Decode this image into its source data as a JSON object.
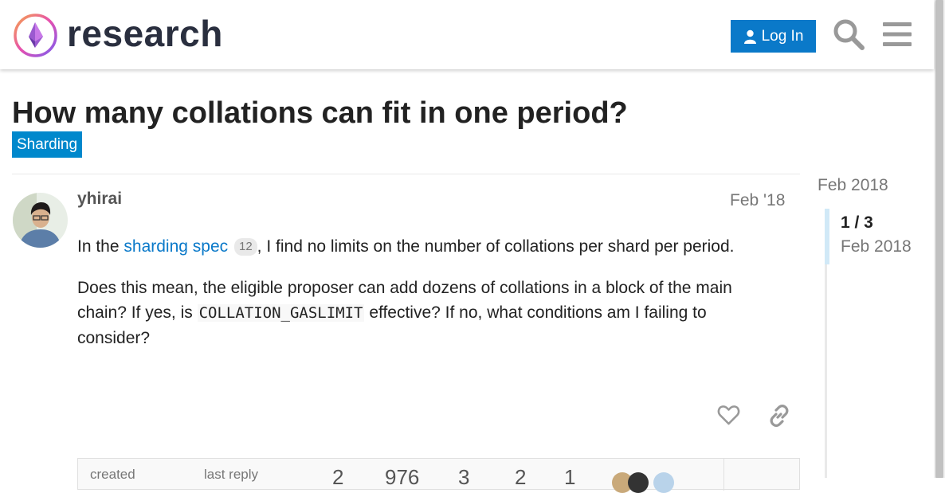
{
  "header": {
    "brand": "research",
    "login_label": "Log In"
  },
  "topic": {
    "title": "How many collations can fit in one period?",
    "category": "Sharding"
  },
  "post": {
    "username": "yhirai",
    "date": "Feb '18",
    "p1_before": "In the ",
    "p1_link": "sharding spec",
    "p1_link_clicks": "12",
    "p1_after": ", I find no limits on the number of collations per shard per period.",
    "p2_before": "Does this mean, the eligible proposer can add dozens of collations in a block of the main chain? If yes, is ",
    "p2_code": "COLLATION_GASLIMIT",
    "p2_after": " effective? If no, what conditions am I failing to consider?"
  },
  "topic_map": {
    "created_label": "created",
    "last_reply_label": "last reply",
    "stats": [
      "2",
      "976",
      "3",
      "2",
      "1"
    ]
  },
  "timeline": {
    "top_date": "Feb 2018",
    "position": "1 / 3",
    "current_date": "Feb 2018"
  },
  "colors": {
    "accent": "#0a79c9",
    "category": "#0088cc"
  }
}
